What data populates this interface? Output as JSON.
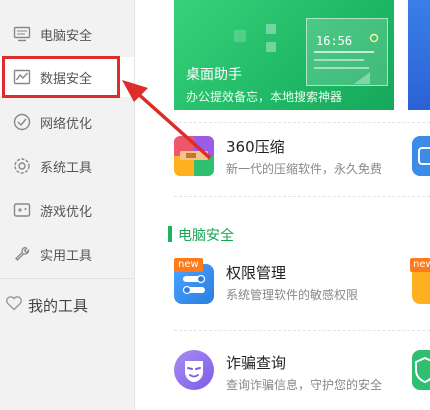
{
  "sidebar": {
    "items": [
      {
        "label": "电脑安全",
        "icon": "monitor-icon"
      },
      {
        "label": "数据安全",
        "icon": "activity-chart-icon"
      },
      {
        "label": "网络优化",
        "icon": "network-check-icon"
      },
      {
        "label": "系统工具",
        "icon": "gear-icon"
      },
      {
        "label": "游戏优化",
        "icon": "game-controller-icon"
      },
      {
        "label": "实用工具",
        "icon": "wrench-icon"
      }
    ],
    "my_tools": {
      "label": "我的工具",
      "icon": "heart-icon"
    }
  },
  "banner": {
    "title": "桌面助手",
    "subtitle": "办公提效备忘，本地搜索神器",
    "time": "16:56"
  },
  "apps": {
    "compress": {
      "name": "360压缩",
      "desc": "新一代的压缩软件，永久免费"
    },
    "permission": {
      "name": "权限管理",
      "desc": "系统管理软件的敏感权限",
      "badge": "new"
    },
    "fraud": {
      "name": "诈骗查询",
      "desc": "查询诈骗信息，守护您的安全"
    }
  },
  "section": {
    "title": "电脑安全"
  },
  "edge": {
    "badge": "new"
  },
  "colors": {
    "accent": "#1cb55e",
    "highlight": "#e02b2b",
    "arrow": "#e02b2b"
  }
}
